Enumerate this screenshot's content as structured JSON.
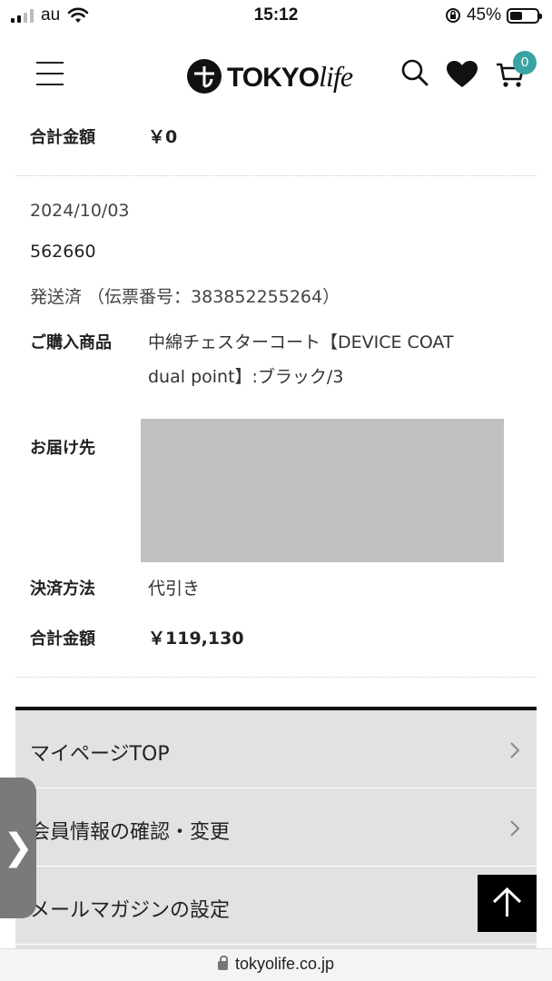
{
  "status_bar": {
    "carrier": "au",
    "time": "15:12",
    "battery": "45%",
    "battery_level": 0.45
  },
  "header": {
    "logo_main": "TOKYO",
    "logo_script": "life",
    "cart_count": "0"
  },
  "previous_order": {
    "total_label": "合計金額",
    "total_value": "￥0"
  },
  "order": {
    "date": "2024/10/03",
    "number": "562660",
    "status": "発送済 （伝票番号：383852255264）",
    "product_label": "ご購入商品",
    "product_line1": "中綿チェスターコート【DEVICE COAT",
    "product_line2": "dual point】:ブラック/3",
    "address_label": "お届け先",
    "payment_label": "決済方法",
    "payment_value": "代引き",
    "total_label": "合計金額",
    "total_value": "￥119,130"
  },
  "menu": {
    "items": [
      {
        "label": "マイページTOP"
      },
      {
        "label": "会員情報の確認・変更"
      },
      {
        "label": "メールマガジンの設定"
      }
    ]
  },
  "side_tab": {
    "glyph": "❯"
  },
  "url_bar": {
    "domain": "tokyolife.co.jp"
  },
  "colors": {
    "accent": "#3aa3a3",
    "menu_bg": "#e2e2e2",
    "redaction": "#c0c0c0"
  }
}
